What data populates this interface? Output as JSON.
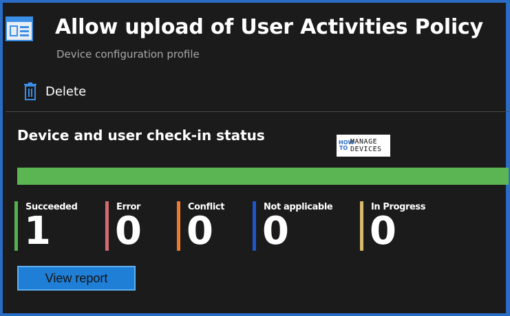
{
  "header": {
    "title": "Allow upload of User Activities Policy",
    "subtitle": "Device configuration profile",
    "icon": "blade-icon"
  },
  "toolbar": {
    "delete_label": "Delete",
    "delete_icon": "trash-icon"
  },
  "section": {
    "title": "Device and user check-in status"
  },
  "logo": {
    "how_to": "HOW TO",
    "line1": "MANAGE",
    "line2": "DEVICES"
  },
  "status_bar": {
    "succeeded_fraction": 1.0,
    "color": "#5bb553"
  },
  "stats": [
    {
      "label": "Succeeded",
      "value": "1",
      "color": "#57b04f"
    },
    {
      "label": "Error",
      "value": "0",
      "color": "#d06c70"
    },
    {
      "label": "Conflict",
      "value": "0",
      "color": "#ef7b30"
    },
    {
      "label": "Not applicable",
      "value": "0",
      "color": "#1d57c9"
    },
    {
      "label": "In Progress",
      "value": "0",
      "color": "#d9b96b"
    }
  ],
  "actions": {
    "view_report_label": "View report"
  },
  "colors": {
    "accent_border": "#2a6bc4",
    "button_fill": "#1f7fd6"
  }
}
